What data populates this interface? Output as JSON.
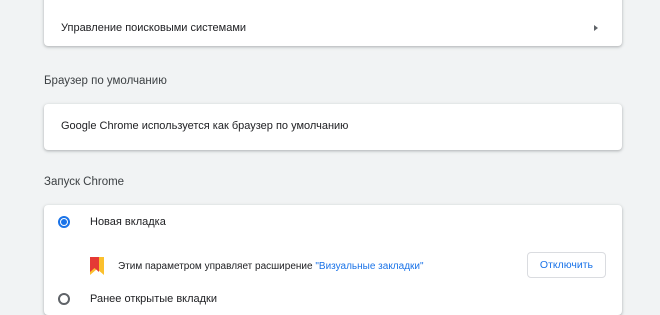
{
  "search_engines": {
    "manage_label": "Управление поисковыми системами",
    "chevron_icon": "chevron-right-icon"
  },
  "default_browser": {
    "title": "Браузер по умолчанию",
    "status_text": "Google Chrome используется как браузер по умолчанию"
  },
  "startup": {
    "title": "Запуск Chrome",
    "option_new_tab": "Новая вкладка",
    "option_continue": "Ранее открытые вкладки",
    "extension_notice_prefix": "Этим параметром управляет расширение ",
    "extension_name": "\"Визуальные закладки\"",
    "extension_icon": "bookmark-flag-icon",
    "disable_button": "Отключить"
  },
  "colors": {
    "accent": "#1a73e8",
    "background": "#f1f3f4",
    "card": "#ffffff",
    "extension_red": "#e53935",
    "extension_yellow": "#fbc02d"
  }
}
